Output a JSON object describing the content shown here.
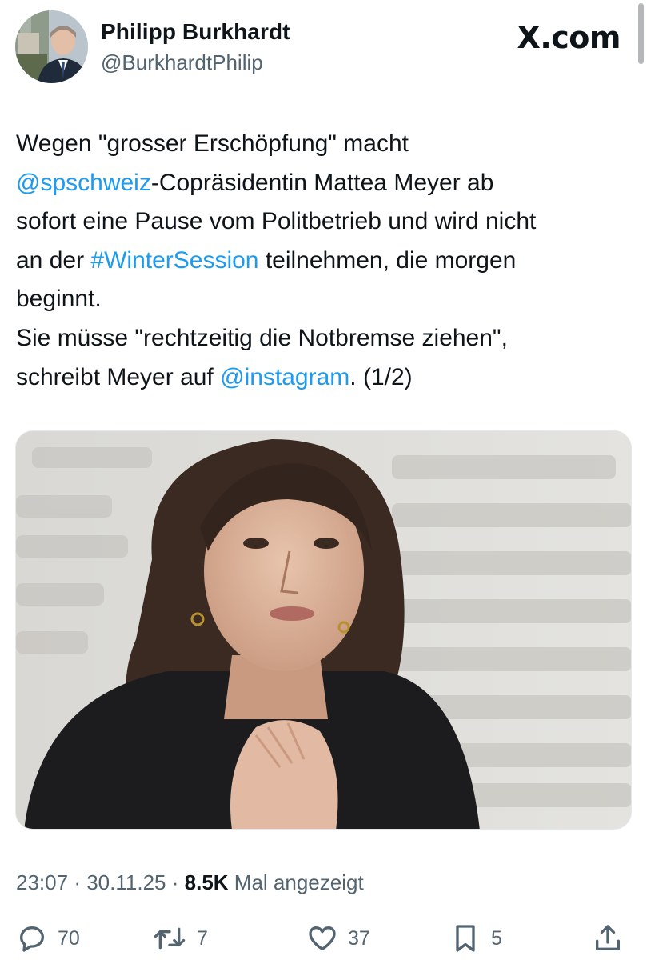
{
  "header": {
    "display_name": "Philipp Burkhardt",
    "handle": "@BurkhardtPhilip",
    "brand": "X.com"
  },
  "tweet": {
    "segments": [
      {
        "text": "Wegen \"grosser Erschöpfung\" macht\n",
        "type": "text"
      },
      {
        "text": "@spschweiz",
        "type": "link"
      },
      {
        "text": "-Copräsidentin Mattea Meyer ab\nsofort eine Pause vom Politbetrieb und wird nicht\nan der ",
        "type": "text"
      },
      {
        "text": "#WinterSession",
        "type": "link"
      },
      {
        "text": " teilnehmen, die morgen\nbeginnt.\nSie müsse \"rechtzeitig die Notbremse ziehen\",\nschreibt Meyer auf ",
        "type": "text"
      },
      {
        "text": "@instagram",
        "type": "link"
      },
      {
        "text": ". (1/2)",
        "type": "text"
      }
    ]
  },
  "meta": {
    "time": "23:07",
    "date": "30.11.25",
    "separator": "·",
    "views": "8.5K",
    "views_label": "Mal angezeigt"
  },
  "actions": {
    "replies": "70",
    "reposts": "7",
    "likes": "37",
    "bookmarks": "5"
  },
  "colors": {
    "link": "#1d9bf0",
    "secondary_text": "#536471",
    "primary_text": "#0f1419"
  },
  "icons": {
    "reply": "reply-icon",
    "repost": "repost-icon",
    "like": "heart-icon",
    "bookmark": "bookmark-icon",
    "share": "share-icon"
  }
}
